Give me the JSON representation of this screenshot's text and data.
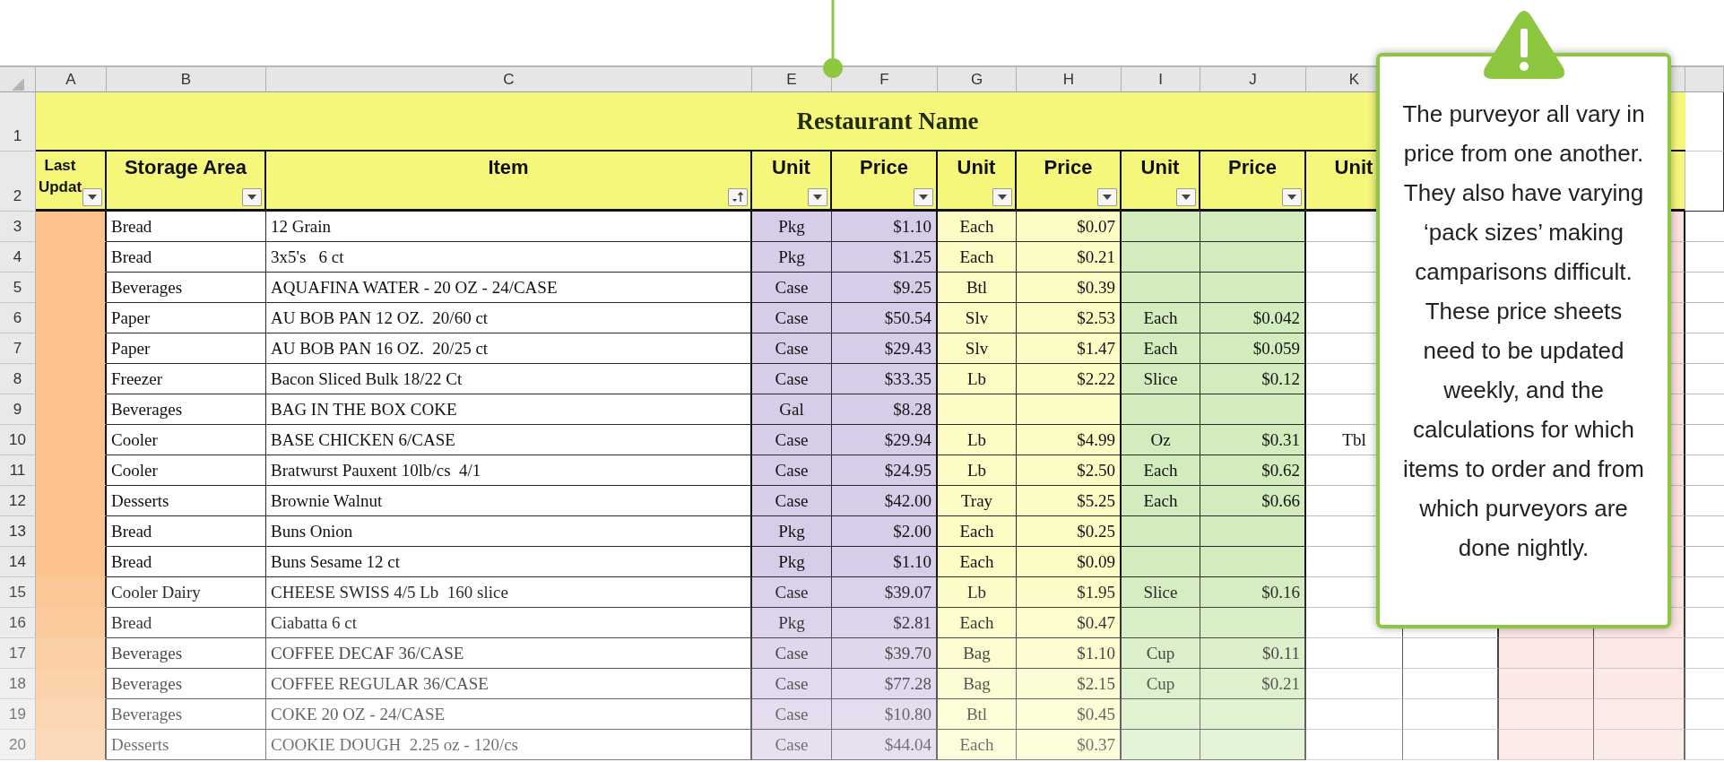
{
  "column_letters": [
    "A",
    "B",
    "C",
    "E",
    "F",
    "G",
    "H",
    "I",
    "J",
    "K"
  ],
  "title": "Restaurant Name",
  "header_row_number": "1",
  "columns_row_number": "2",
  "columns": [
    {
      "label": "Last Updat",
      "sorted": false,
      "dropdown": true
    },
    {
      "label": "Storage Area",
      "sorted": false,
      "dropdown": true
    },
    {
      "label": "Item",
      "sorted": true,
      "dropdown": true
    },
    {
      "label": "Unit",
      "sorted": false,
      "dropdown": true
    },
    {
      "label": "Price",
      "sorted": false,
      "dropdown": true
    },
    {
      "label": "Unit",
      "sorted": false,
      "dropdown": true
    },
    {
      "label": "Price",
      "sorted": false,
      "dropdown": true
    },
    {
      "label": "Unit",
      "sorted": false,
      "dropdown": true
    },
    {
      "label": "Price",
      "sorted": false,
      "dropdown": true
    },
    {
      "label": "Unit",
      "dropdown": false
    }
  ],
  "rows": [
    {
      "number": "3",
      "storage": "Bread",
      "item": "12 Grain",
      "unit_1": "Pkg",
      "price_1": "$1.10",
      "unit_2": "Each",
      "price_2": "$0.07"
    },
    {
      "number": "4",
      "storage": "Bread",
      "item": "3x5's   6 ct",
      "unit_1": "Pkg",
      "price_1": "$1.25",
      "unit_2": "Each",
      "price_2": "$0.21"
    },
    {
      "number": "5",
      "storage": "Beverages",
      "item": "AQUAFINA WATER - 20 OZ - 24/CASE",
      "unit_1": "Case",
      "price_1": "$9.25",
      "unit_2": "Btl",
      "price_2": "$0.39"
    },
    {
      "number": "6",
      "storage": "Paper",
      "item": "AU BOB PAN 12 OZ.  20/60 ct",
      "unit_1": "Case",
      "price_1": "$50.54",
      "unit_2": "Slv",
      "price_2": "$2.53",
      "unit_3": "Each",
      "price_3": "$0.042"
    },
    {
      "number": "7",
      "storage": "Paper",
      "item": "AU BOB PAN 16 OZ.  20/25 ct",
      "unit_1": "Case",
      "price_1": "$29.43",
      "unit_2": "Slv",
      "price_2": "$1.47",
      "unit_3": "Each",
      "price_3": "$0.059"
    },
    {
      "number": "8",
      "storage": "Freezer",
      "item": "Bacon Sliced Bulk 18/22 Ct",
      "unit_1": "Case",
      "price_1": "$33.35",
      "unit_2": "Lb",
      "price_2": "$2.22",
      "unit_3": "Slice",
      "price_3": "$0.12"
    },
    {
      "number": "9",
      "storage": "Beverages",
      "item": "BAG IN THE BOX COKE",
      "unit_1": "Gal",
      "price_1": "$8.28"
    },
    {
      "number": "10",
      "storage": "Cooler",
      "item": "BASE CHICKEN 6/CASE",
      "unit_1": "Case",
      "price_1": "$29.94",
      "unit_2": "Lb",
      "price_2": "$4.99",
      "unit_3": "Oz",
      "price_3": "$0.31",
      "column_k": "Tbl"
    },
    {
      "number": "11",
      "storage": "Cooler",
      "item": "Bratwurst Pauxent 10lb/cs  4/1",
      "unit_1": "Case",
      "price_1": "$24.95",
      "unit_2": "Lb",
      "price_2": "$2.50",
      "unit_3": "Each",
      "price_3": "$0.62"
    },
    {
      "number": "12",
      "storage": "Desserts",
      "item": "Brownie Walnut",
      "unit_1": "Case",
      "price_1": "$42.00",
      "unit_2": "Tray",
      "price_2": "$5.25",
      "unit_3": "Each",
      "price_3": "$0.66"
    },
    {
      "number": "13",
      "storage": "Bread",
      "item": "Buns Onion",
      "unit_1": "Pkg",
      "price_1": "$2.00",
      "unit_2": "Each",
      "price_2": "$0.25"
    },
    {
      "number": "14",
      "storage": "Bread",
      "item": "Buns Sesame 12 ct",
      "unit_1": "Pkg",
      "price_1": "$1.10",
      "unit_2": "Each",
      "price_2": "$0.09"
    },
    {
      "number": "15",
      "storage": "Cooler Dairy",
      "item": "CHEESE SWISS 4/5 Lb  160 slice",
      "unit_1": "Case",
      "price_1": "$39.07",
      "unit_2": "Lb",
      "price_2": "$1.95",
      "unit_3": "Slice",
      "price_3": "$0.16"
    },
    {
      "number": "16",
      "storage": "Bread",
      "item": "Ciabatta 6 ct",
      "unit_1": "Pkg",
      "price_1": "$2.81",
      "unit_2": "Each",
      "price_2": "$0.47"
    },
    {
      "number": "17",
      "storage": "Beverages",
      "item": "COFFEE DECAF 36/CASE",
      "unit_1": "Case",
      "price_1": "$39.70",
      "unit_2": "Bag",
      "price_2": "$1.10",
      "unit_3": "Cup",
      "price_3": "$0.11"
    },
    {
      "number": "18",
      "storage": "Beverages",
      "item": "COFFEE REGULAR 36/CASE",
      "unit_1": "Case",
      "price_1": "$77.28",
      "unit_2": "Bag",
      "price_2": "$2.15",
      "unit_3": "Cup",
      "price_3": "$0.21"
    },
    {
      "number": "19",
      "storage": "Beverages",
      "item": "COKE 20 OZ - 24/CASE",
      "unit_1": "Case",
      "price_1": "$10.80",
      "unit_2": "Btl",
      "price_2": "$0.45"
    },
    {
      "number": "20",
      "storage": "Desserts",
      "item": "COOKIE DOUGH  2.25 oz - 120/cs",
      "unit_1": "Case",
      "price_1": "$44.04",
      "unit_2": "Each",
      "price_2": "$0.37"
    }
  ],
  "callout": {
    "text": "The purveyor all vary in price from one another. They also have varying ‘pack sizes’ making camparisons difficult. These price sheets need to be updated weekly, and the calculations for which items to order and from which purveyors are done nightly."
  }
}
